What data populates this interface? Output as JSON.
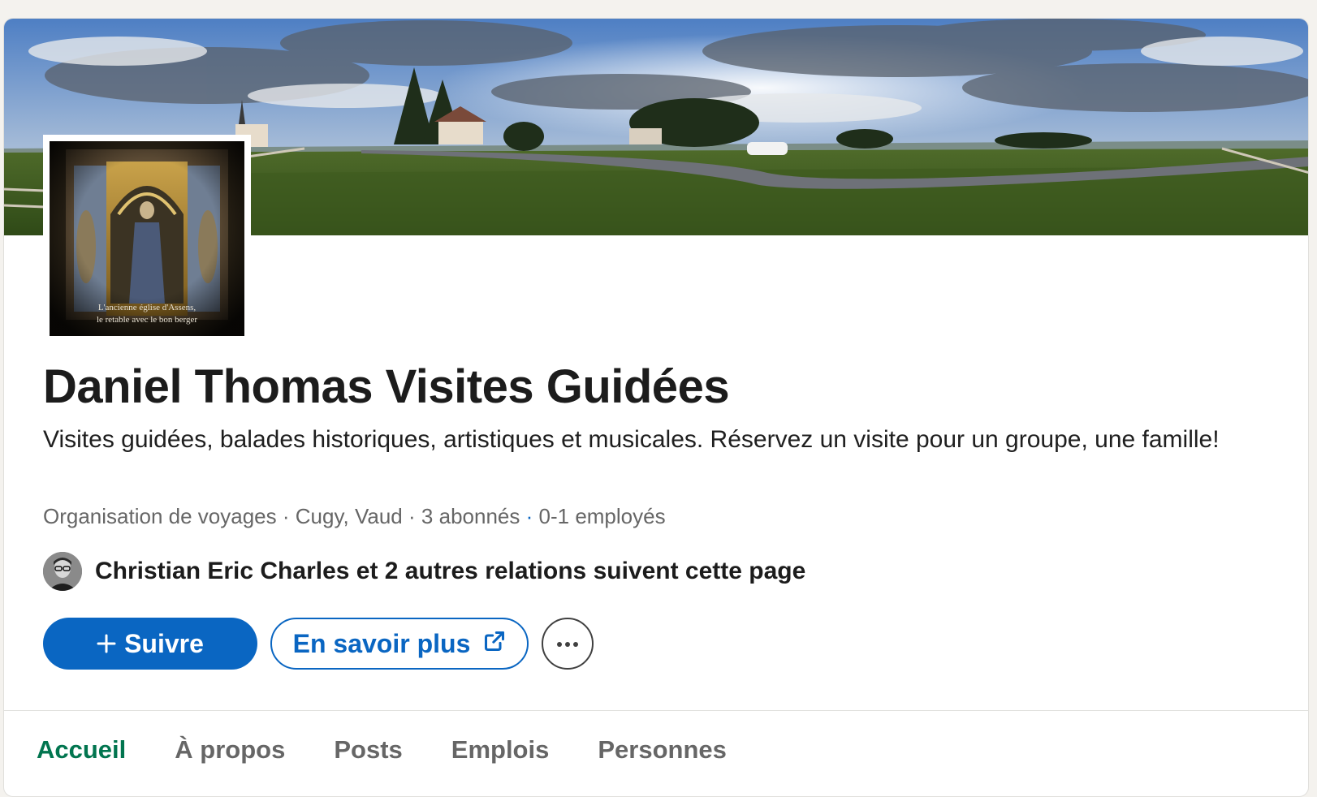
{
  "company": {
    "name": "Daniel Thomas Visites Guidées",
    "tagline": "Visites guidées, balades historiques, artistiques et musicales. Réservez un visite pour un groupe, une famille!",
    "meta": {
      "industry": "Organisation de voyages",
      "location": "Cugy, Vaud",
      "followers": "3 abonnés",
      "employees": "0-1 employés",
      "separator": "·"
    },
    "logo": {
      "caption_line1": "L'ancienne église d'Assens,",
      "caption_line2": "le retable avec le bon berger"
    }
  },
  "followers_note": "Christian Eric Charles et 2 autres relations suivent cette page",
  "actions": {
    "follow_label": "Suivre",
    "learn_more_label": "En savoir plus"
  },
  "tabs": [
    {
      "label": "Accueil",
      "active": true
    },
    {
      "label": "À propos",
      "active": false
    },
    {
      "label": "Posts",
      "active": false
    },
    {
      "label": "Emplois",
      "active": false
    },
    {
      "label": "Personnes",
      "active": false
    }
  ],
  "colors": {
    "primary": "#0a66c2",
    "active_tab": "#01754f",
    "muted_text": "#666666"
  },
  "icons": [
    "plus-icon",
    "external-link-icon",
    "more-icon"
  ]
}
